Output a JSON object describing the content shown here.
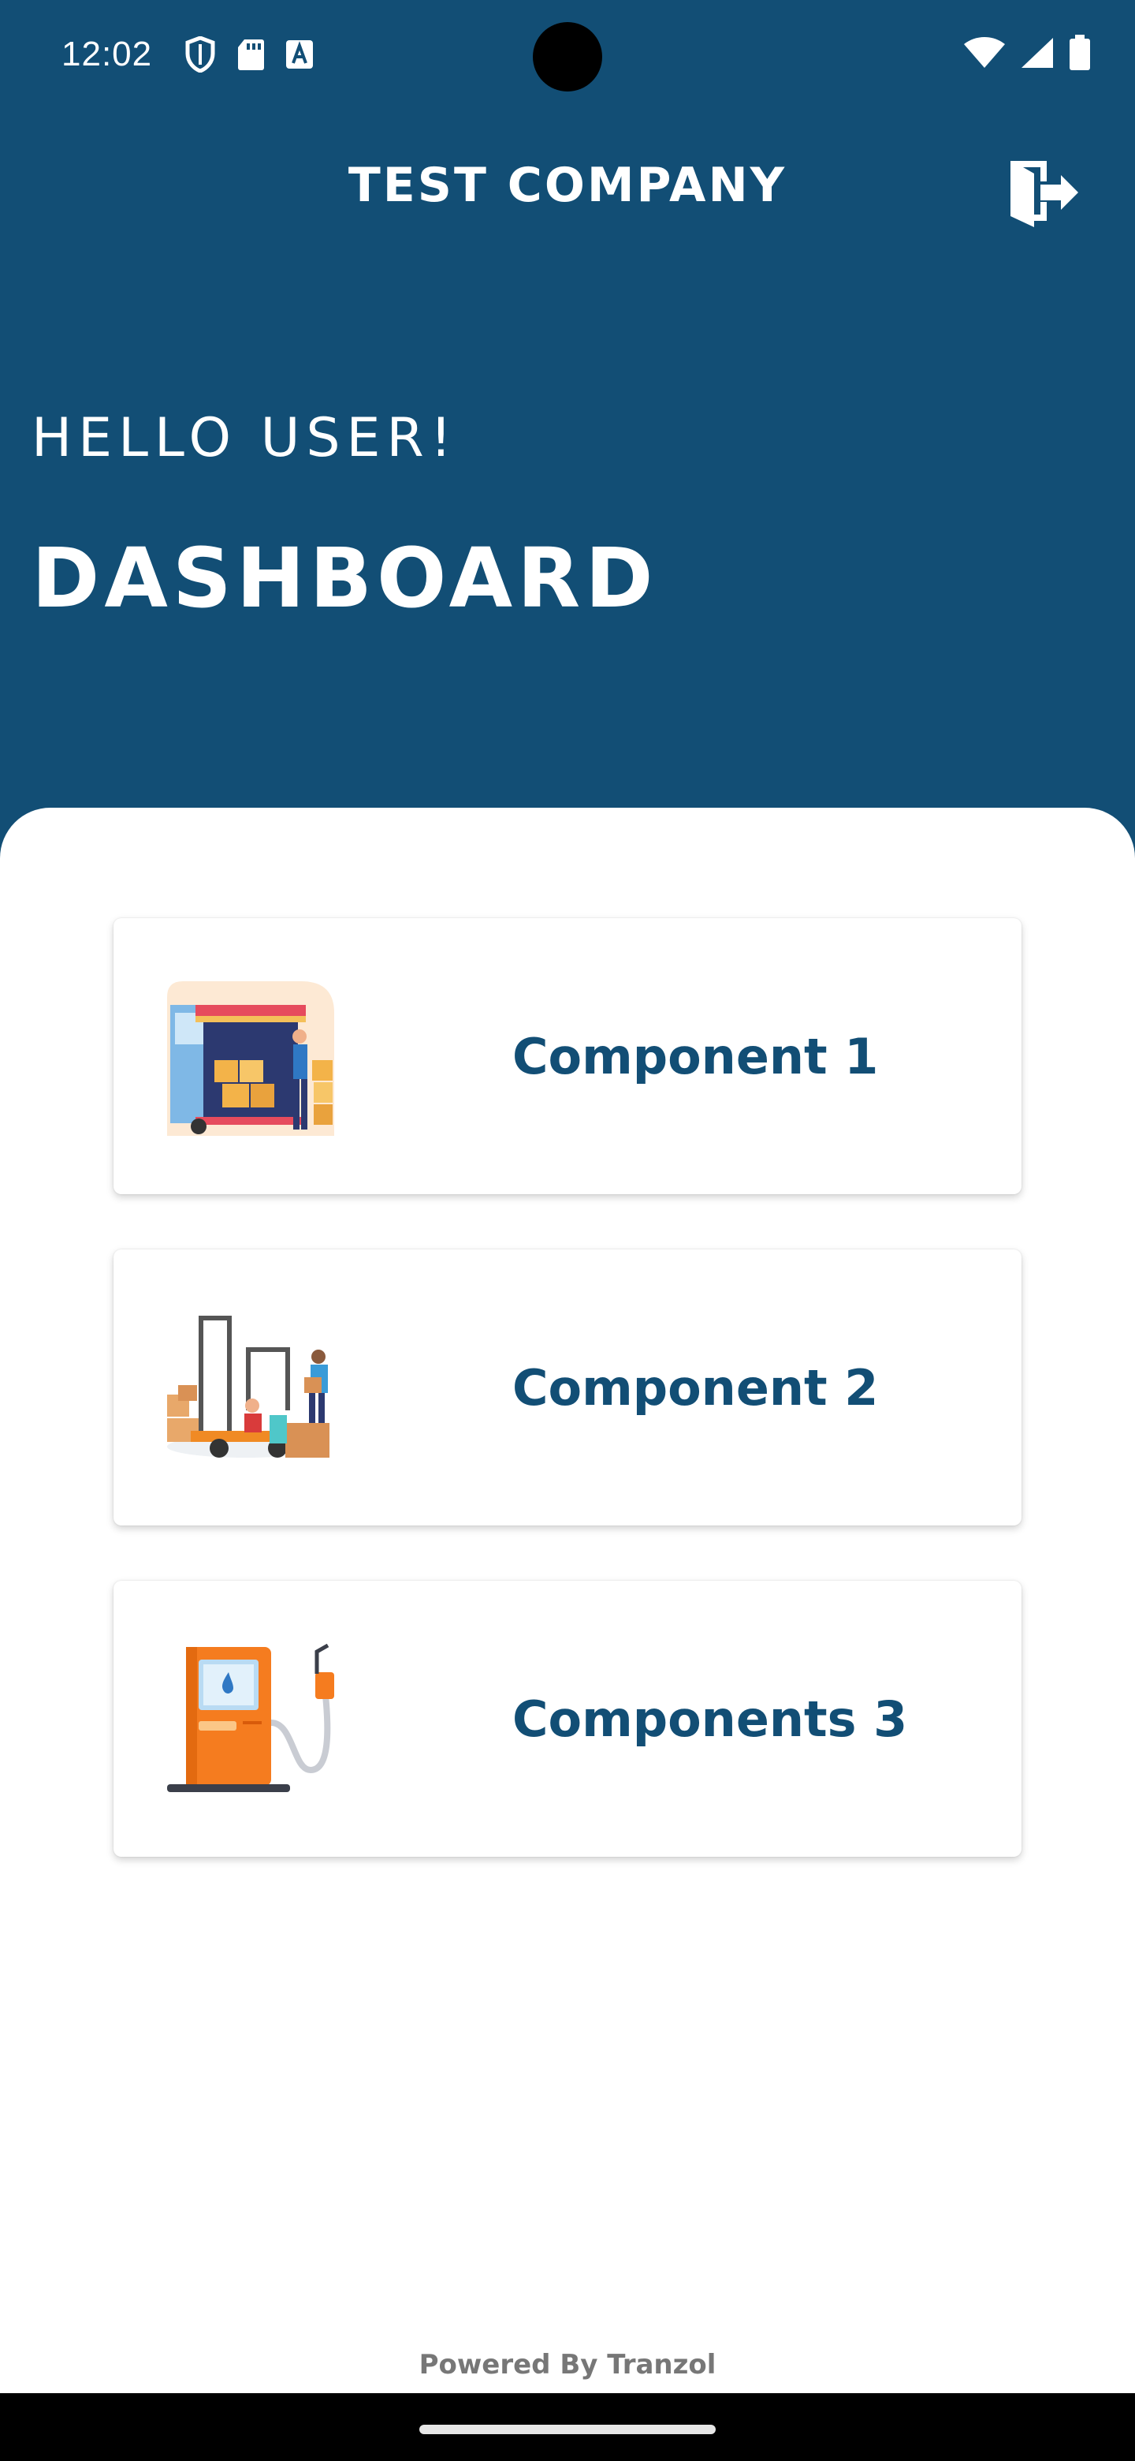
{
  "status_bar": {
    "time": "12:02",
    "left_icons": [
      "shield-icon",
      "sd-card-icon",
      "font-icon"
    ],
    "right_icons": [
      "wifi-icon",
      "signal-icon",
      "battery-icon"
    ]
  },
  "header": {
    "company_name": "TEST COMPANY",
    "logout_icon": "logout-door-icon",
    "greeting": "HELLO USER!",
    "title": "DASHBOARD"
  },
  "cards": [
    {
      "label": "Component 1",
      "icon": "delivery-truck-illustration"
    },
    {
      "label": "Component 2",
      "icon": "forklift-warehouse-illustration"
    },
    {
      "label": "Components 3",
      "icon": "fuel-pump-illustration"
    }
  ],
  "footer": {
    "text": "Powered By Tranzol"
  },
  "colors": {
    "primary": "#124e75",
    "background": "#ffffff"
  }
}
